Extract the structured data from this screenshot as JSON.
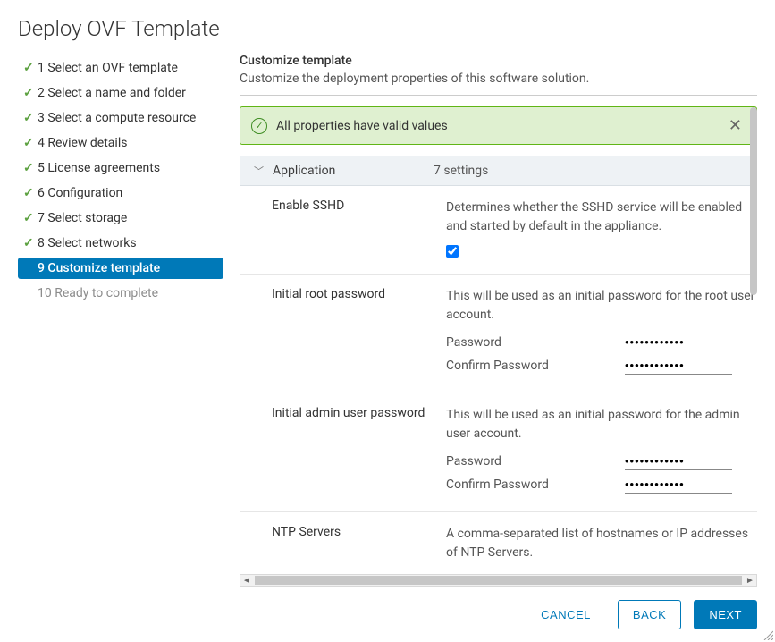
{
  "title": "Deploy OVF Template",
  "steps": [
    {
      "n": "1",
      "label": "Select an OVF template",
      "state": "completed"
    },
    {
      "n": "2",
      "label": "Select a name and folder",
      "state": "completed"
    },
    {
      "n": "3",
      "label": "Select a compute resource",
      "state": "completed"
    },
    {
      "n": "4",
      "label": "Review details",
      "state": "completed"
    },
    {
      "n": "5",
      "label": "License agreements",
      "state": "completed"
    },
    {
      "n": "6",
      "label": "Configuration",
      "state": "completed"
    },
    {
      "n": "7",
      "label": "Select storage",
      "state": "completed"
    },
    {
      "n": "8",
      "label": "Select networks",
      "state": "completed"
    },
    {
      "n": "9",
      "label": "Customize template",
      "state": "active"
    },
    {
      "n": "10",
      "label": "Ready to complete",
      "state": "pending"
    }
  ],
  "content": {
    "heading": "Customize template",
    "sub": "Customize the deployment properties of this software solution."
  },
  "alert": {
    "text": "All properties have valid values"
  },
  "section": {
    "name": "Application",
    "count": "7 settings"
  },
  "fieldlabels": {
    "password": "Password",
    "confirm": "Confirm Password"
  },
  "props": {
    "sshd": {
      "label": "Enable SSHD",
      "desc": "Determines whether the SSHD service will be enabled and started by default in the appliance.",
      "checked": true
    },
    "root": {
      "label": "Initial root password",
      "desc": "This will be used as an initial password for the root user account.",
      "pw": "••••••••••••",
      "cpw": "••••••••••••"
    },
    "admin": {
      "label": "Initial admin user password",
      "desc": "This will be used as an initial password for the admin user account.",
      "pw": "••••••••••••",
      "cpw": "••••••••••••"
    },
    "ntp": {
      "label": "NTP Servers",
      "desc": "A comma-separated list of hostnames or IP addresses of NTP Servers."
    }
  },
  "buttons": {
    "cancel": "CANCEL",
    "back": "BACK",
    "next": "NEXT"
  }
}
